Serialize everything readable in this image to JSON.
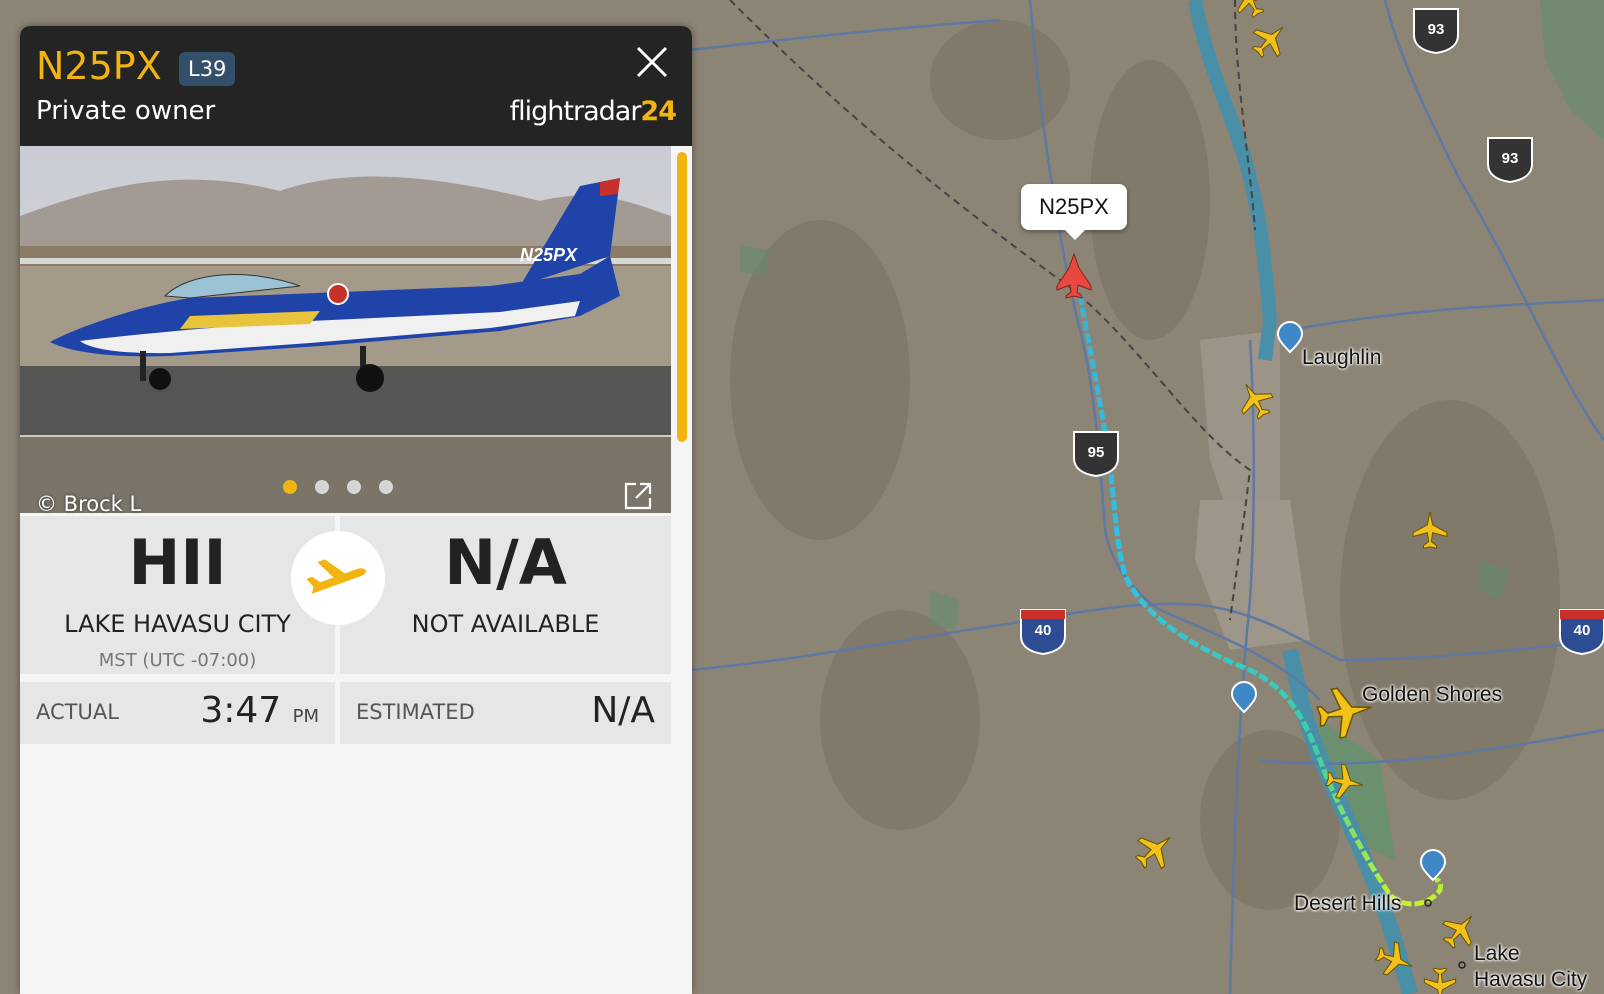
{
  "flight": {
    "registration": "N25PX",
    "aircraft_type": "L39",
    "owner": "Private owner",
    "brand_name": "flightradar",
    "brand_number": "24",
    "photo_credit": "© Brock L",
    "photo_tail_text": "N25PX",
    "photo_count": 4,
    "photo_active_index": 0
  },
  "route": {
    "origin": {
      "code": "HII",
      "city": "LAKE HAVASU CITY",
      "timezone": "MST (UTC -07:00)"
    },
    "destination": {
      "code": "N/A",
      "city": "NOT AVAILABLE"
    }
  },
  "times": {
    "actual_label": "ACTUAL",
    "actual_value": "3:47",
    "actual_ampm": "PM",
    "estimated_label": "ESTIMATED",
    "estimated_value": "N/A"
  },
  "map": {
    "callout": "N25PX",
    "places": [
      "Laughlin",
      "Golden Shores",
      "Desert Hills",
      "Lake",
      "Havasu City"
    ],
    "routes": [
      "93",
      "93",
      "95",
      "40",
      "40"
    ]
  },
  "colors": {
    "accent": "#f2b40f",
    "header_bg": "#242424",
    "badge_bg": "#344f69",
    "selected_plane": "#e8483f"
  }
}
